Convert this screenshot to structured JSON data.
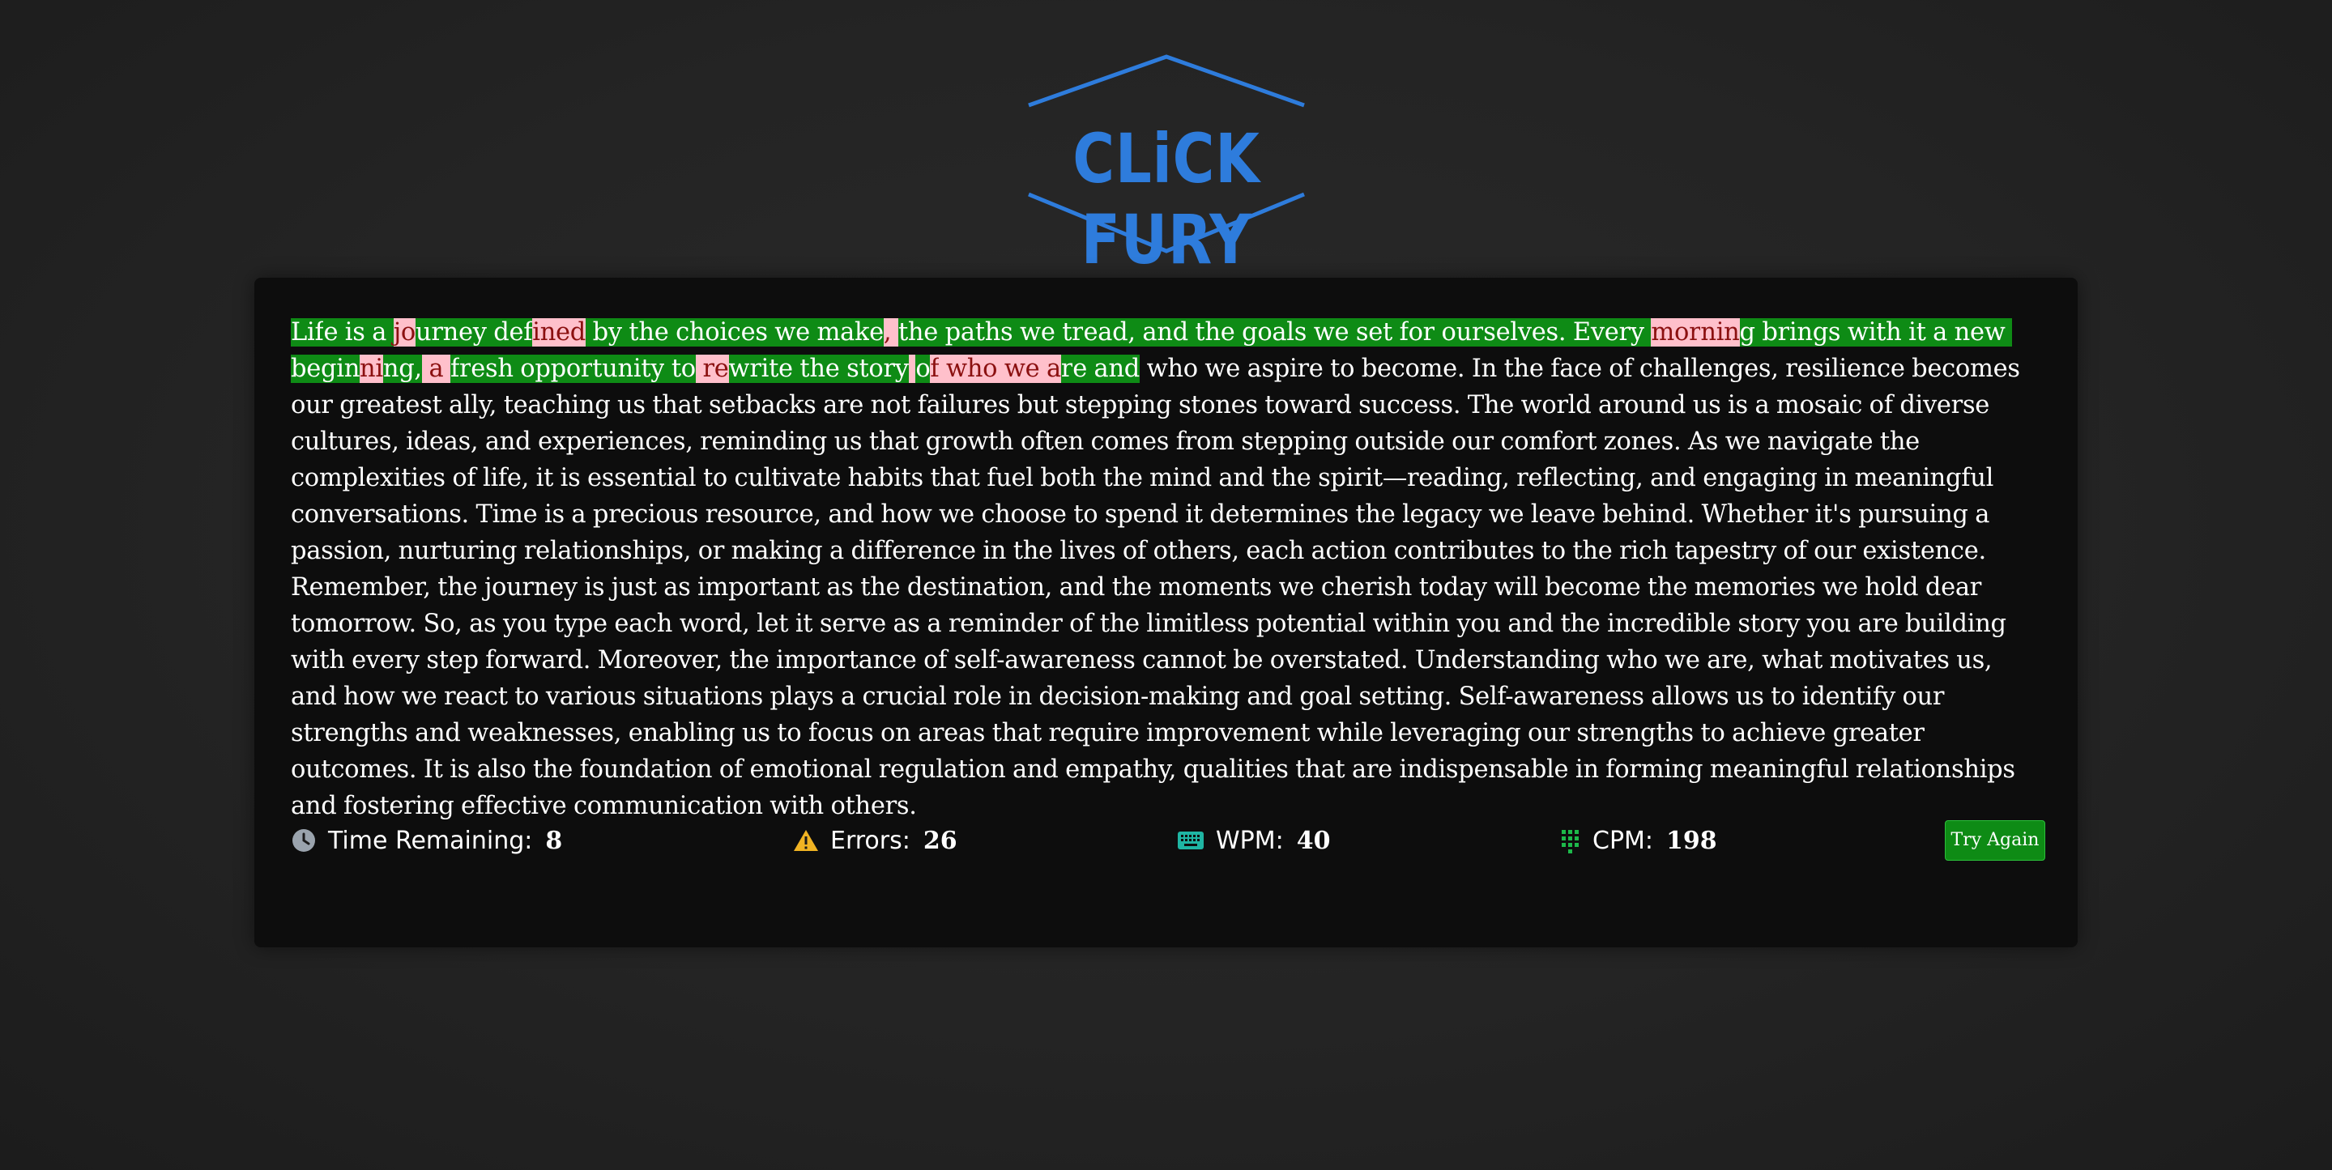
{
  "logo": {
    "text": "CLiCK FURY",
    "color": "#2e7cdc"
  },
  "passage": {
    "text": "Life is a journey defined by the choices we make, the paths we tread, and the goals we set for ourselves. Every morning brings with it a new beginning, a fresh opportunity to rewrite the story of who we are and who we aspire to become. In the face of challenges, resilience becomes our greatest ally, teaching us that setbacks are not failures but stepping stones toward success. The world around us is a mosaic of diverse cultures, ideas, and experiences, reminding us that growth often comes from stepping outside our comfort zones. As we navigate the complexities of life, it is essential to cultivate habits that fuel both the mind and the spirit—reading, reflecting, and engaging in meaningful conversations. Time is a precious resource, and how we choose to spend it determines the legacy we leave behind. Whether it's pursuing a passion, nurturing relationships, or making a difference in the lives of others, each action contributes to the rich tapestry of our existence. Remember, the journey is just as important as the destination, and the moments we cherish today will become the memories we hold dear tomorrow. So, as you type each word, let it serve as a reminder of the limitless potential within you and the incredible story you are building with every step forward. Moreover, the importance of self-awareness cannot be overstated. Understanding who we are, what motivates us, and how we react to various situations plays a crucial role in decision-making and goal setting. Self-awareness allows us to identify our strengths and weaknesses, enabling us to focus on areas that require improvement while leveraging our strengths to achieve greater outcomes. It is also the foundation of emotional regulation and empathy, qualities that are indispensable in forming meaningful relationships and fostering effective communication with others.",
    "typed_count": 210,
    "error_ranges": [
      [
        10,
        11
      ],
      [
        21,
        24
      ],
      [
        48,
        49
      ],
      [
        112,
        117
      ],
      [
        146,
        147
      ],
      [
        151,
        153
      ],
      [
        174,
        176
      ],
      [
        192,
        192
      ],
      [
        194,
        203
      ]
    ],
    "cursor_index": 210,
    "colors": {
      "correct": "#0e8b15",
      "error": "#ffc0cb"
    }
  },
  "stats": {
    "time": {
      "label": "Time Remaining:",
      "value": "8"
    },
    "errors": {
      "label": "Errors:",
      "value": "26"
    },
    "wpm": {
      "label": "WPM:",
      "value": "40"
    },
    "cpm": {
      "label": "CPM:",
      "value": "198"
    }
  },
  "try_again_label": "Try Again",
  "icons": {
    "time": "clock-icon",
    "errors": "warning-icon",
    "wpm": "keyboard-icon",
    "cpm": "keypad-icon"
  }
}
